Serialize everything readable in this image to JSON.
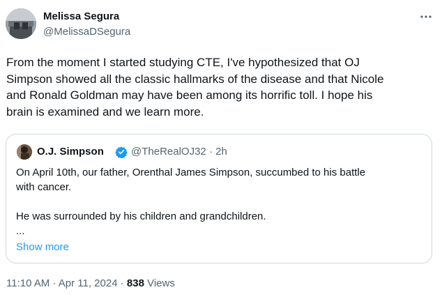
{
  "author": {
    "name": "Melissa Segura",
    "handle": "@MelissaDSegura"
  },
  "tweet": {
    "text": "From the moment I started studying CTE, I've hypothesized that OJ\nSimpson showed all the classic hallmarks of the disease and that Nicole\nand Ronald Goldman may have been among its horrific toll. I hope his\nbrain is examined and we learn more."
  },
  "quote": {
    "name": "O.J. Simpson",
    "handle_time": "@TheRealOJ32 · 2h",
    "text": "On April 10th, our father, Orenthal James Simpson, succumbed to his battle\nwith cancer.\n\nHe was surrounded by his children and grandchildren.\n...",
    "show_more_label": "Show more"
  },
  "meta": {
    "timestamp": "11:10 AM · Apr 11, 2024 · ",
    "views_count": "838",
    "views_label": " Views"
  },
  "icons": {
    "more": "more-horizontal-icon",
    "verified": "verified-badge-icon"
  },
  "colors": {
    "verified_blue": "#1d9bf0",
    "link_blue": "#1d9bf0",
    "secondary_text": "#536471",
    "border": "#cfd9de"
  }
}
